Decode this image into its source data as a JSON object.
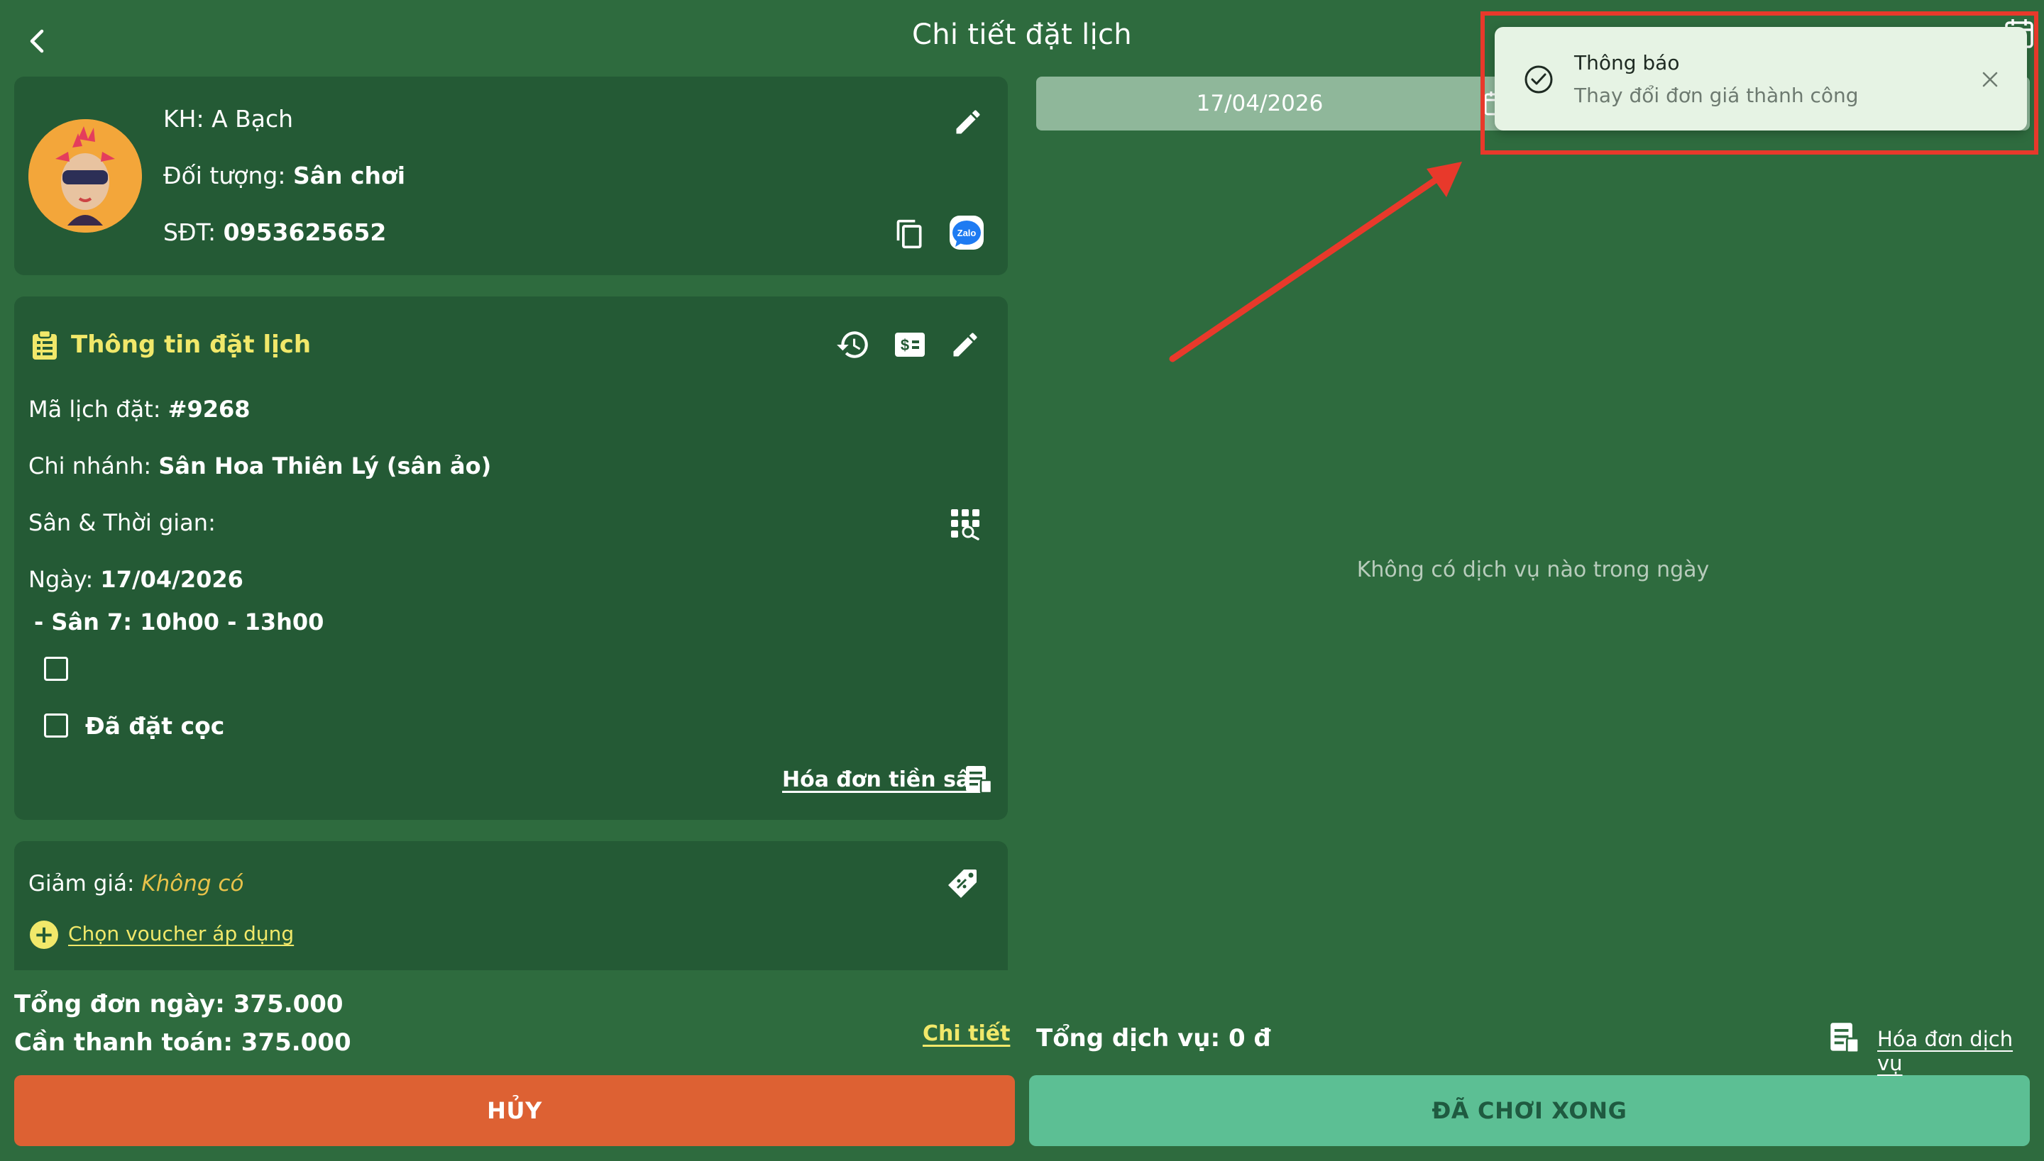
{
  "header": {
    "title": "Chi tiết đặt lịch"
  },
  "customer": {
    "name_label": "KH:",
    "name_value": "A Bạch",
    "type_label": "Đối tượng:",
    "type_value": "Sân chơi",
    "phone_label": "SĐT:",
    "phone_value": "0953625652",
    "zalo_label": "Zalo"
  },
  "booking": {
    "section_title": "Thông tin đặt lịch",
    "code_label": "Mã lịch đặt:",
    "code_value": "#9268",
    "branch_label": "Chi nhánh:",
    "branch_value": "Sân Hoa Thiên Lý (sân ảo)",
    "court_time_label": "Sân & Thời gian:",
    "date_label": "Ngày:",
    "date_value": "17/04/2026",
    "slot": "- Sân 7: 10h00 - 13h00",
    "deposit_label": "Đã đặt cọc",
    "invoice_link": "Hóa đơn tiền sân"
  },
  "discount": {
    "label": "Giảm giá:",
    "value": "Không có",
    "voucher_link": "Chọn voucher áp dụng"
  },
  "totals": {
    "day_total_label": "Tổng đơn ngày:",
    "day_total_value": "375.000",
    "to_pay_label": "Cần thanh toán:",
    "to_pay_value": "375.000",
    "detail_link": "Chi tiết"
  },
  "buttons": {
    "cancel": "HỦY",
    "done": "ĐÃ CHƠI XONG"
  },
  "services": {
    "date": "17/04/2026",
    "empty_message": "Không có dịch vụ nào trong ngày",
    "total_label": "Tổng dịch vụ:",
    "total_value": "0 đ",
    "invoice_link": "Hóa đơn dịch vụ"
  },
  "notification": {
    "title": "Thông báo",
    "message": "Thay đổi đơn giá thành công"
  },
  "colors": {
    "background": "#2e6b3e",
    "card": "#245a35",
    "accent_yellow": "#f1e86a",
    "cancel": "#dd6133",
    "done": "#5cbf94",
    "highlight": "#e8392b"
  }
}
